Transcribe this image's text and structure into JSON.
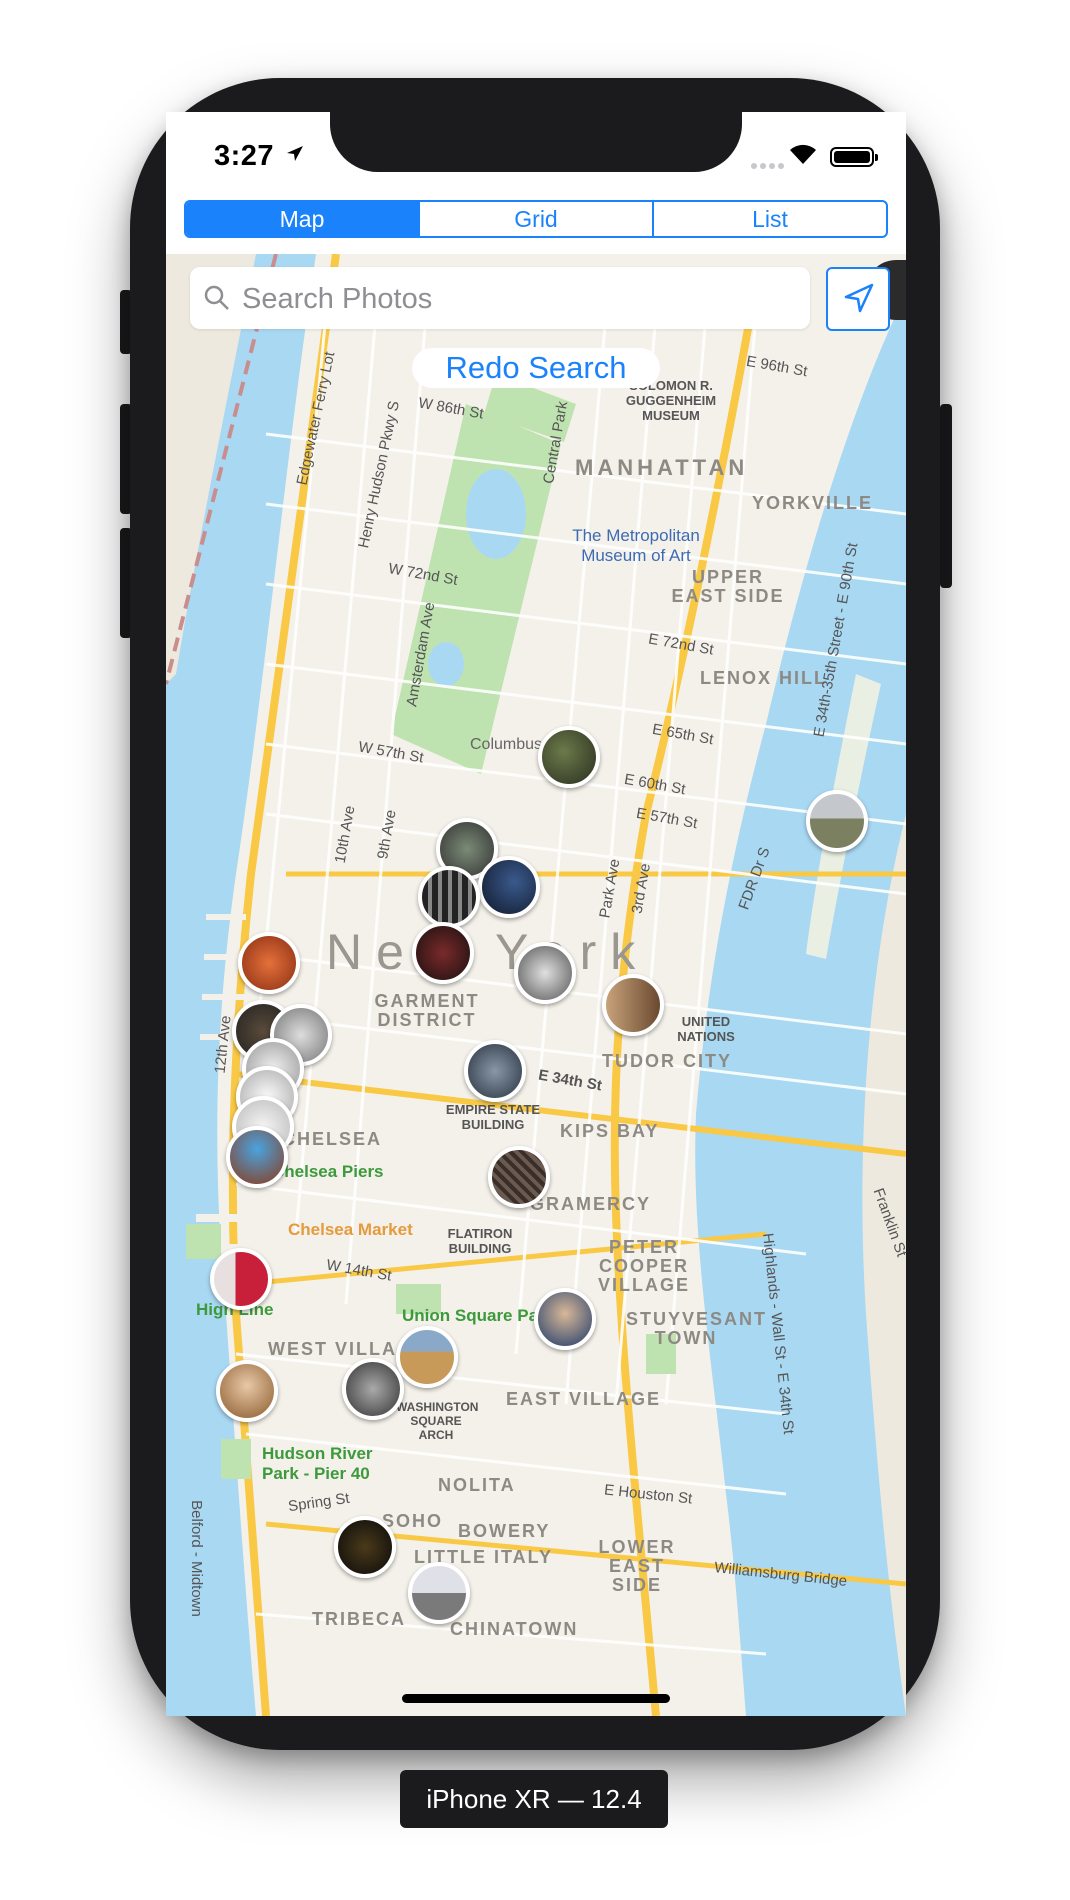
{
  "status": {
    "time": "3:27"
  },
  "tabs": [
    {
      "label": "Map",
      "selected": true
    },
    {
      "label": "Grid",
      "selected": false
    },
    {
      "label": "List",
      "selected": false
    }
  ],
  "search": {
    "placeholder": "Search Photos",
    "value": ""
  },
  "redo_label": "Redo Search",
  "map": {
    "city_label": "New York",
    "areas": [
      "MANHATTAN",
      "YORKVILLE",
      "UPPER EAST SIDE",
      "LENOX HILL",
      "GARMENT DISTRICT",
      "TUDOR CITY",
      "KIPS BAY",
      "CHELSEA",
      "GRAMERCY",
      "PETER COOPER VILLAGE",
      "STUYVESANT TOWN",
      "WEST VILLAGE",
      "EAST VILLAGE",
      "NOLITA",
      "SOHO",
      "BOWERY",
      "LITTLE ITALY",
      "LOWER EAST SIDE",
      "TRIBECA",
      "CHINATOWN"
    ],
    "landmarks": [
      "SOLOMON R. GUGGENHEIM MUSEUM",
      "The Metropolitan Museum of Art",
      "Columbus Circle",
      "EMPIRE STATE BUILDING",
      "FLATIRON BUILDING",
      "UNITED NATIONS",
      "WASHINGTON SQUARE ARCH"
    ],
    "parks": [
      "Chelsea Piers",
      "Chelsea Market",
      "High Line",
      "Union Square Park",
      "Hudson River Park - Pier 40"
    ],
    "streets": [
      "E 96th St",
      "W 86th St",
      "W 72nd St",
      "E 72nd St",
      "E 65th St",
      "W 57th St",
      "E 60th St",
      "E 57th St",
      "E 34th St",
      "W 14th St",
      "Spring St",
      "E Houston St",
      "Williamsburg Bridge",
      "FDR Dr S",
      "Edgewater Ferry Lot",
      "Henry Hudson Pkwy S",
      "Amsterdam Ave",
      "10th Ave",
      "9th Ave",
      "Park Ave",
      "3rd Ave",
      "12th Ave",
      "Central Park",
      "Highlands - Wall St - E 34th St",
      "E 34th-35th Street - E 90th St",
      "Franklin St",
      "Belford - Midtown"
    ]
  },
  "device_label": "iPhone XR — 12.4",
  "colors": {
    "accent": "#1a82fb",
    "water": "#a9d8f3",
    "park": "#bfe3b0",
    "land": "#f4f1ea",
    "highway": "#f9c946"
  }
}
